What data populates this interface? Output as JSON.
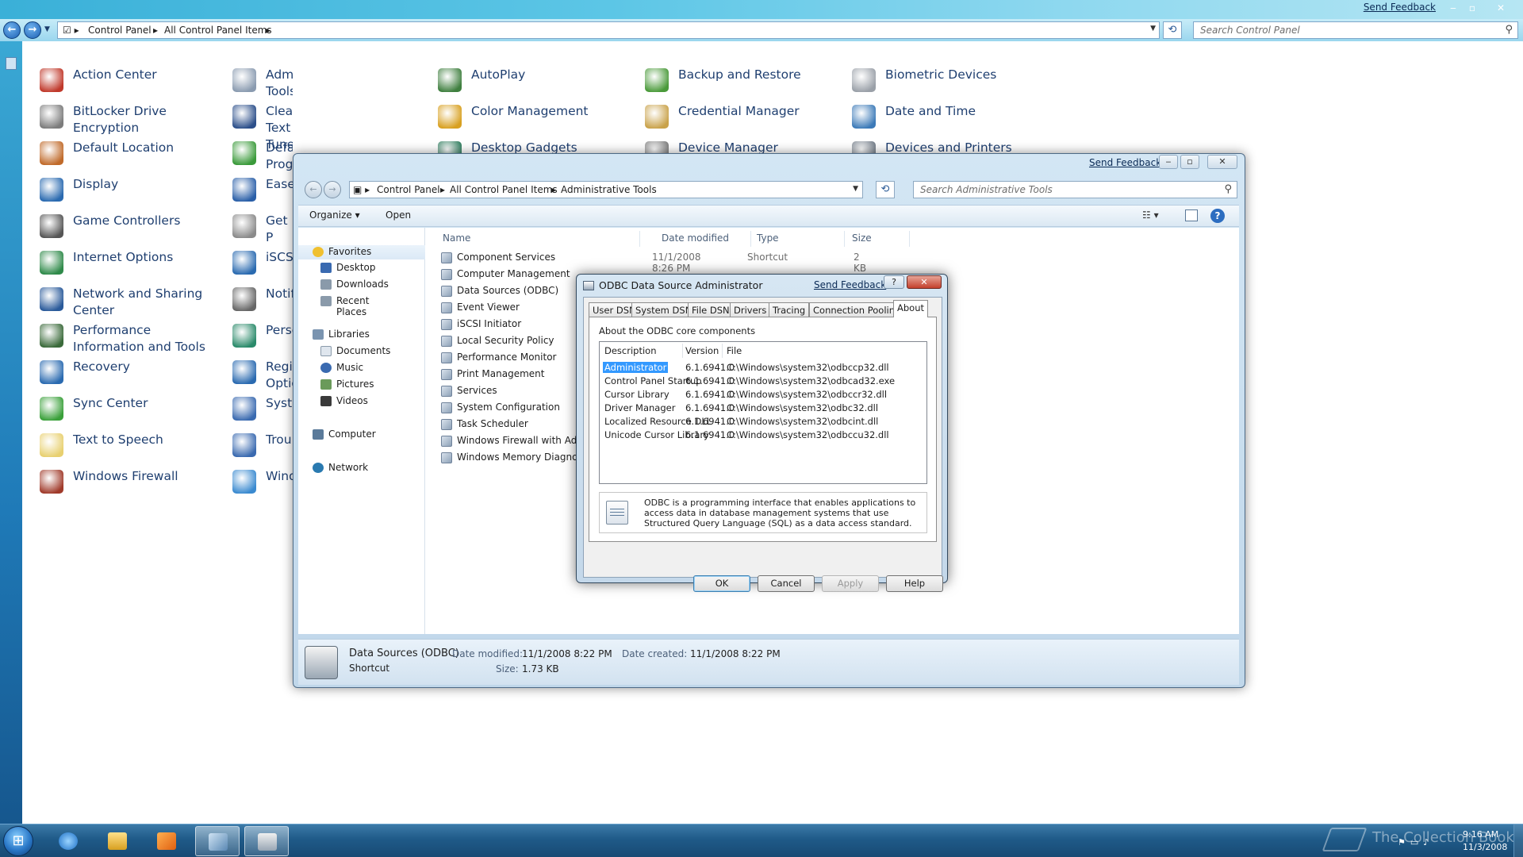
{
  "control_panel": {
    "send_feedback": "Send Feedback",
    "breadcrumb": [
      "Control Panel",
      "All Control Panel Items"
    ],
    "search_placeholder": "Search Control Panel",
    "items": [
      {
        "label": "Action Center",
        "icon": "flag-shield-icon",
        "color": "#c0392b"
      },
      {
        "label": "Administrative Tools",
        "icon": "admin-tools-icon",
        "color": "#8a9bb0"
      },
      {
        "label": "AutoPlay",
        "icon": "autoplay-icon",
        "color": "#3f7f3f"
      },
      {
        "label": "Backup and Restore",
        "icon": "backup-icon",
        "color": "#4a9a3a"
      },
      {
        "label": "Biometric Devices",
        "icon": "fingerprint-icon",
        "color": "#9aa0a8"
      },
      {
        "label": "BitLocker Drive Encryption",
        "icon": "bitlocker-icon",
        "color": "#7c7c7c"
      },
      {
        "label": "ClearType Text Tuner",
        "icon": "cleartype-icon",
        "color": "#2c4f8a"
      },
      {
        "label": "Color Management",
        "icon": "color-management-icon",
        "color": "#d8a020"
      },
      {
        "label": "Credential Manager",
        "icon": "credential-vault-icon",
        "color": "#c9a24a"
      },
      {
        "label": "Date and Time",
        "icon": "calendar-clock-icon",
        "color": "#3c7ab8"
      },
      {
        "label": "Default Location",
        "icon": "house-icon",
        "color": "#c06a2a"
      },
      {
        "label": "Default Programs",
        "icon": "default-programs-icon",
        "color": "#3a9a3a"
      },
      {
        "label": "Desktop Gadgets",
        "icon": "gadgets-icon",
        "color": "#2a7a5a"
      },
      {
        "label": "Device Manager",
        "icon": "device-manager-icon",
        "color": "#7a7a7a"
      },
      {
        "label": "Devices and Printers",
        "icon": "printer-icon",
        "color": "#707a86"
      },
      {
        "label": "Display",
        "icon": "monitor-icon",
        "color": "#2a6ab0"
      },
      {
        "label": "Ease",
        "icon": "ease-of-access-icon",
        "color": "#2a5fa8"
      },
      {
        "label": "Game Controllers",
        "icon": "gamepad-icon",
        "color": "#555"
      },
      {
        "label": "Get P",
        "icon": "get-programs-icon",
        "color": "#8a8a8a"
      },
      {
        "label": "Internet Options",
        "icon": "globe-icon",
        "color": "#2f8a4a"
      },
      {
        "label": "iSCS",
        "icon": "iscsi-icon",
        "color": "#2a6ab0"
      },
      {
        "label": "Network and Sharing Center",
        "icon": "network-icon",
        "color": "#2a5a9a"
      },
      {
        "label": "Notif",
        "icon": "notification-icon",
        "color": "#666"
      },
      {
        "label": "Performance Information and Tools",
        "icon": "performance-icon",
        "color": "#3a6a3a"
      },
      {
        "label": "Perso",
        "icon": "personalization-icon",
        "color": "#2a8a6a"
      },
      {
        "label": "Recovery",
        "icon": "recovery-icon",
        "color": "#2a6ab0"
      },
      {
        "label": "Regi Optio",
        "icon": "region-globe-icon",
        "color": "#2a6ab0"
      },
      {
        "label": "Sync Center",
        "icon": "sync-icon",
        "color": "#3aa03a"
      },
      {
        "label": "Syste",
        "icon": "system-icon",
        "color": "#3a6ab0"
      },
      {
        "label": "Text to Speech",
        "icon": "speech-bubble-icon",
        "color": "#e8d070"
      },
      {
        "label": "Trou",
        "icon": "troubleshoot-icon",
        "color": "#3a6ab0"
      },
      {
        "label": "Windows Firewall",
        "icon": "firewall-icon",
        "color": "#a03a2a"
      },
      {
        "label": "Wind",
        "icon": "windows-update-icon",
        "color": "#3a8ad0"
      }
    ]
  },
  "admin_tools": {
    "send_feedback": "Send Feedback",
    "breadcrumb": [
      "Control Panel",
      "All Control Panel Items",
      "Administrative Tools"
    ],
    "search_placeholder": "Search Administrative Tools",
    "toolbar": {
      "organize": "Organize ▾",
      "open": "Open",
      "views": "☷ ▾"
    },
    "nav_pane": {
      "favorites": "Favorites",
      "favorites_items": [
        "Desktop",
        "Downloads",
        "Recent Places"
      ],
      "libraries": "Libraries",
      "libraries_items": [
        "Documents",
        "Music",
        "Pictures",
        "Videos"
      ],
      "computer": "Computer",
      "network": "Network"
    },
    "columns": {
      "name": "Name",
      "date": "Date modified",
      "type": "Type",
      "size": "Size"
    },
    "files": [
      {
        "name": "Component Services",
        "date": "11/1/2008 8:26 PM",
        "type": "Shortcut",
        "size": "2 KB"
      },
      {
        "name": "Computer Management",
        "date": "",
        "type": "",
        "size": ""
      },
      {
        "name": "Data Sources (ODBC)",
        "date": "",
        "type": "",
        "size": ""
      },
      {
        "name": "Event Viewer",
        "date": "",
        "type": "",
        "size": ""
      },
      {
        "name": "iSCSI Initiator",
        "date": "",
        "type": "",
        "size": ""
      },
      {
        "name": "Local Security Policy",
        "date": "",
        "type": "",
        "size": ""
      },
      {
        "name": "Performance Monitor",
        "date": "",
        "type": "",
        "size": ""
      },
      {
        "name": "Print Management",
        "date": "",
        "type": "",
        "size": ""
      },
      {
        "name": "Services",
        "date": "",
        "type": "",
        "size": ""
      },
      {
        "name": "System Configuration",
        "date": "",
        "type": "",
        "size": ""
      },
      {
        "name": "Task Scheduler",
        "date": "",
        "type": "",
        "size": ""
      },
      {
        "name": "Windows Firewall with Adva",
        "date": "",
        "type": "",
        "size": ""
      },
      {
        "name": "Windows Memory Diagnost",
        "date": "",
        "type": "",
        "size": ""
      }
    ],
    "details": {
      "name": "Data Sources (ODBC)",
      "kind": "Shortcut",
      "date_modified_label": "Date modified:",
      "date_modified": "11/1/2008 8:22 PM",
      "date_created_label": "Date created:",
      "date_created": "11/1/2008 8:22 PM",
      "size_label": "Size:",
      "size": "1.73 KB"
    }
  },
  "odbc": {
    "title": "ODBC Data Source Administrator",
    "send_feedback": "Send Feedback",
    "tabs": [
      "User DSN",
      "System DSN",
      "File DSN",
      "Drivers",
      "Tracing",
      "Connection Pooling",
      "About"
    ],
    "active_tab": "About",
    "section_label": "About the ODBC core components",
    "headers": {
      "description": "Description",
      "version": "Version",
      "file": "File"
    },
    "components": [
      {
        "description": "Administrator",
        "version": "6.1.6941.0",
        "file": "C:\\Windows\\system32\\odbccp32.dll"
      },
      {
        "description": "Control Panel Startup",
        "version": "6.1.6941.0",
        "file": "C:\\Windows\\system32\\odbcad32.exe"
      },
      {
        "description": "Cursor Library",
        "version": "6.1.6941.0",
        "file": "C:\\Windows\\system32\\odbccr32.dll"
      },
      {
        "description": "Driver Manager",
        "version": "6.1.6941.0",
        "file": "C:\\Windows\\system32\\odbc32.dll"
      },
      {
        "description": "Localized Resource DLL",
        "version": "6.1.6941.0",
        "file": "C:\\Windows\\system32\\odbcint.dll"
      },
      {
        "description": "Unicode Cursor Library",
        "version": "6.1.6941.0",
        "file": "C:\\Windows\\system32\\odbccu32.dll"
      }
    ],
    "info_text": "ODBC is a programming interface that enables applications to access data in database management systems that use Structured Query Language (SQL) as a data access standard.",
    "buttons": {
      "ok": "OK",
      "cancel": "Cancel",
      "apply": "Apply",
      "help": "Help"
    }
  },
  "taskbar": {
    "watermark": "The Collection Book",
    "time": "9:16 AM",
    "date": "11/3/2008"
  }
}
